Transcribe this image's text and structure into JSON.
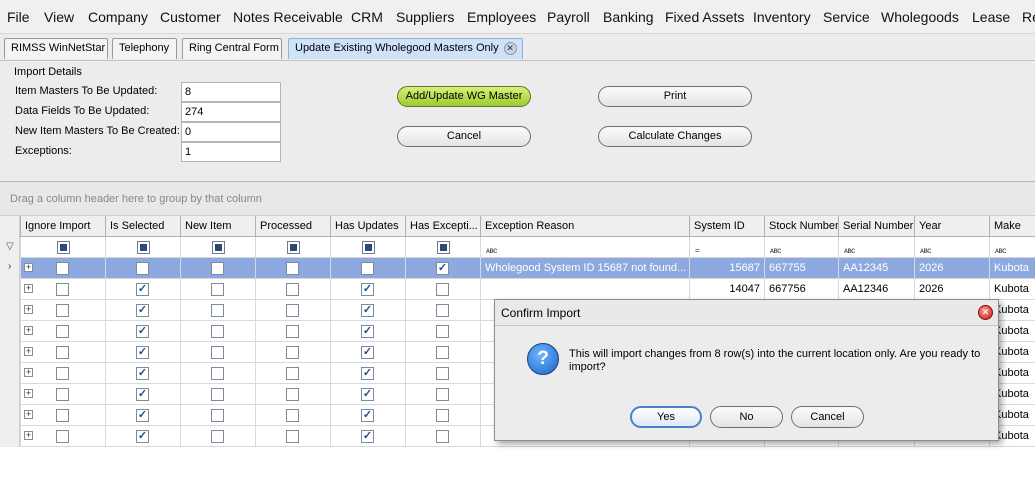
{
  "menu": [
    "File",
    "View",
    "Company",
    "Customer",
    "Notes Receivable",
    "CRM",
    "Suppliers",
    "Employees",
    "Payroll",
    "Banking",
    "Fixed Assets",
    "Inventory",
    "Service",
    "Wholegoods",
    "Lease",
    "Re"
  ],
  "tabs": [
    "RIMSS WinNetStar",
    "Telephony",
    "Ring Central Form",
    "Update Existing Wholegood Masters Only"
  ],
  "tab_close_glyph": "✕",
  "import_details": {
    "title": "Import Details",
    "fields": [
      {
        "label": "Item Masters To Be Updated:",
        "value": "8"
      },
      {
        "label": "Data Fields To Be Updated:",
        "value": "274"
      },
      {
        "label": "New Item Masters To Be Created:",
        "value": "0"
      },
      {
        "label": "Exceptions:",
        "value": "1"
      }
    ]
  },
  "buttons": {
    "add_update": "Add/Update WG Master",
    "print": "Print",
    "cancel": "Cancel",
    "calculate": "Calculate Changes"
  },
  "grid": {
    "group_hint": "Drag a column header here to group by that column",
    "columns": [
      "Ignore Import",
      "Is Selected",
      "New Item",
      "Processed",
      "Has Updates",
      "Has Excepti...",
      "Exception Reason",
      "System ID",
      "Stock Number",
      "Serial Number",
      "Year",
      "Make"
    ],
    "filter_text_glyph": "ᴀʙᴄ",
    "filter_num_glyph": "=",
    "rows": [
      {
        "ignore": false,
        "selected": false,
        "new_item": false,
        "processed": false,
        "has_updates": false,
        "has_exception": true,
        "reason": "Wholegood System ID 15687 not found...",
        "system_id": "15687",
        "stock": "667755",
        "serial": "AA12345",
        "year": "2026",
        "make": "Kubota"
      },
      {
        "ignore": false,
        "selected": true,
        "new_item": false,
        "processed": false,
        "has_updates": true,
        "has_exception": false,
        "reason": "",
        "system_id": "14047",
        "stock": "667756",
        "serial": "AA12346",
        "year": "2026",
        "make": "Kubota"
      },
      {
        "ignore": false,
        "selected": true,
        "new_item": false,
        "processed": false,
        "has_updates": true,
        "has_exception": false,
        "reason": "",
        "system_id": "",
        "stock": "",
        "serial": "",
        "year": "",
        "make": "Kubota"
      },
      {
        "ignore": false,
        "selected": true,
        "new_item": false,
        "processed": false,
        "has_updates": true,
        "has_exception": false,
        "reason": "",
        "system_id": "",
        "stock": "",
        "serial": "",
        "year": "",
        "make": "Kubota"
      },
      {
        "ignore": false,
        "selected": true,
        "new_item": false,
        "processed": false,
        "has_updates": true,
        "has_exception": false,
        "reason": "",
        "system_id": "",
        "stock": "",
        "serial": "",
        "year": "",
        "make": "Kubota"
      },
      {
        "ignore": false,
        "selected": true,
        "new_item": false,
        "processed": false,
        "has_updates": true,
        "has_exception": false,
        "reason": "",
        "system_id": "",
        "stock": "",
        "serial": "",
        "year": "",
        "make": "Kubota"
      },
      {
        "ignore": false,
        "selected": true,
        "new_item": false,
        "processed": false,
        "has_updates": true,
        "has_exception": false,
        "reason": "",
        "system_id": "",
        "stock": "",
        "serial": "",
        "year": "",
        "make": "Kubota"
      },
      {
        "ignore": false,
        "selected": true,
        "new_item": false,
        "processed": false,
        "has_updates": true,
        "has_exception": false,
        "reason": "",
        "system_id": "",
        "stock": "",
        "serial": "",
        "year": "",
        "make": "Kubota"
      },
      {
        "ignore": false,
        "selected": true,
        "new_item": false,
        "processed": false,
        "has_updates": true,
        "has_exception": false,
        "reason": "",
        "system_id": "",
        "stock": "",
        "serial": "",
        "year": "",
        "make": "Kubota"
      }
    ]
  },
  "dialog": {
    "title": "Confirm Import",
    "icon": "question-icon",
    "icon_glyph": "?",
    "message": "This will import changes from 8 row(s) into the current location only. Are you ready to import?",
    "buttons": [
      "Yes",
      "No",
      "Cancel"
    ],
    "close_glyph": "✕"
  },
  "colors": {
    "selected_row": "#8da9e0",
    "accent_button": "#9ccb2f",
    "active_tab": "#cfe3f8"
  }
}
